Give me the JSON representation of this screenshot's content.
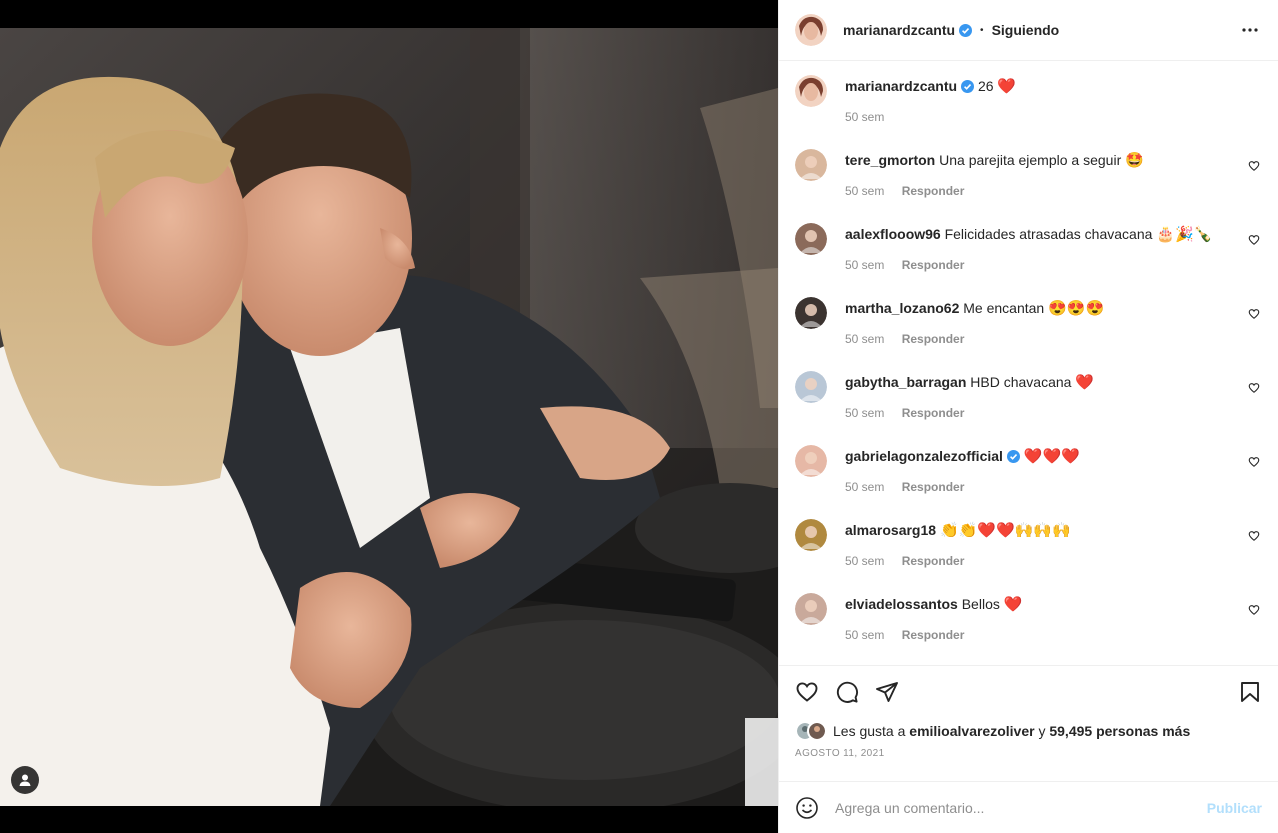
{
  "header": {
    "username": "marianardzcantu",
    "separator": "•",
    "follow_status": "Siguiendo",
    "more_icon": "more-horizontal-icon"
  },
  "caption": {
    "username": "marianardzcantu",
    "text": "26",
    "emoji": "❤️",
    "time": "50 sem"
  },
  "comments": [
    {
      "username": "tere_gmorton",
      "text": "Una parejita ejemplo a seguir",
      "emoji": "🤩",
      "time": "50 sem",
      "reply": "Responder",
      "verified": false
    },
    {
      "username": "aalexflooow96",
      "text": "Felicidades atrasadas chavacana",
      "emoji": "🎂🎉🍾",
      "time": "50 sem",
      "reply": "Responder",
      "verified": false
    },
    {
      "username": "martha_lozano62",
      "text": "Me encantan",
      "emoji": "😍😍😍",
      "time": "50 sem",
      "reply": "Responder",
      "verified": false
    },
    {
      "username": "gabytha_barragan",
      "text": "HBD chavacana",
      "emoji": "❤️",
      "time": "50 sem",
      "reply": "Responder",
      "verified": false
    },
    {
      "username": "gabrielagonzalezofficial",
      "text": "",
      "emoji": "❤️❤️❤️",
      "time": "50 sem",
      "reply": "Responder",
      "verified": true
    },
    {
      "username": "almarosarg18",
      "text": "",
      "emoji": "👏👏❤️❤️🙌🙌🙌",
      "time": "50 sem",
      "reply": "Responder",
      "verified": false
    },
    {
      "username": "elviadelossantos",
      "text": "Bellos",
      "emoji": "❤️",
      "time": "50 sem",
      "reply": "Responder",
      "verified": false
    }
  ],
  "likes": {
    "prefix": "Les gusta a",
    "user": "emilioalvarezoliver",
    "connector": "y",
    "count_text": "59,495 personas más"
  },
  "date": "AGOSTO 11, 2021",
  "add_comment": {
    "placeholder": "Agrega un comentario...",
    "publish": "Publicar"
  },
  "colors": {
    "verified": "#3897f0",
    "heart": "#ed1a3b",
    "publish_disabled": "#b2dffc",
    "meta": "#8e8e8e"
  }
}
